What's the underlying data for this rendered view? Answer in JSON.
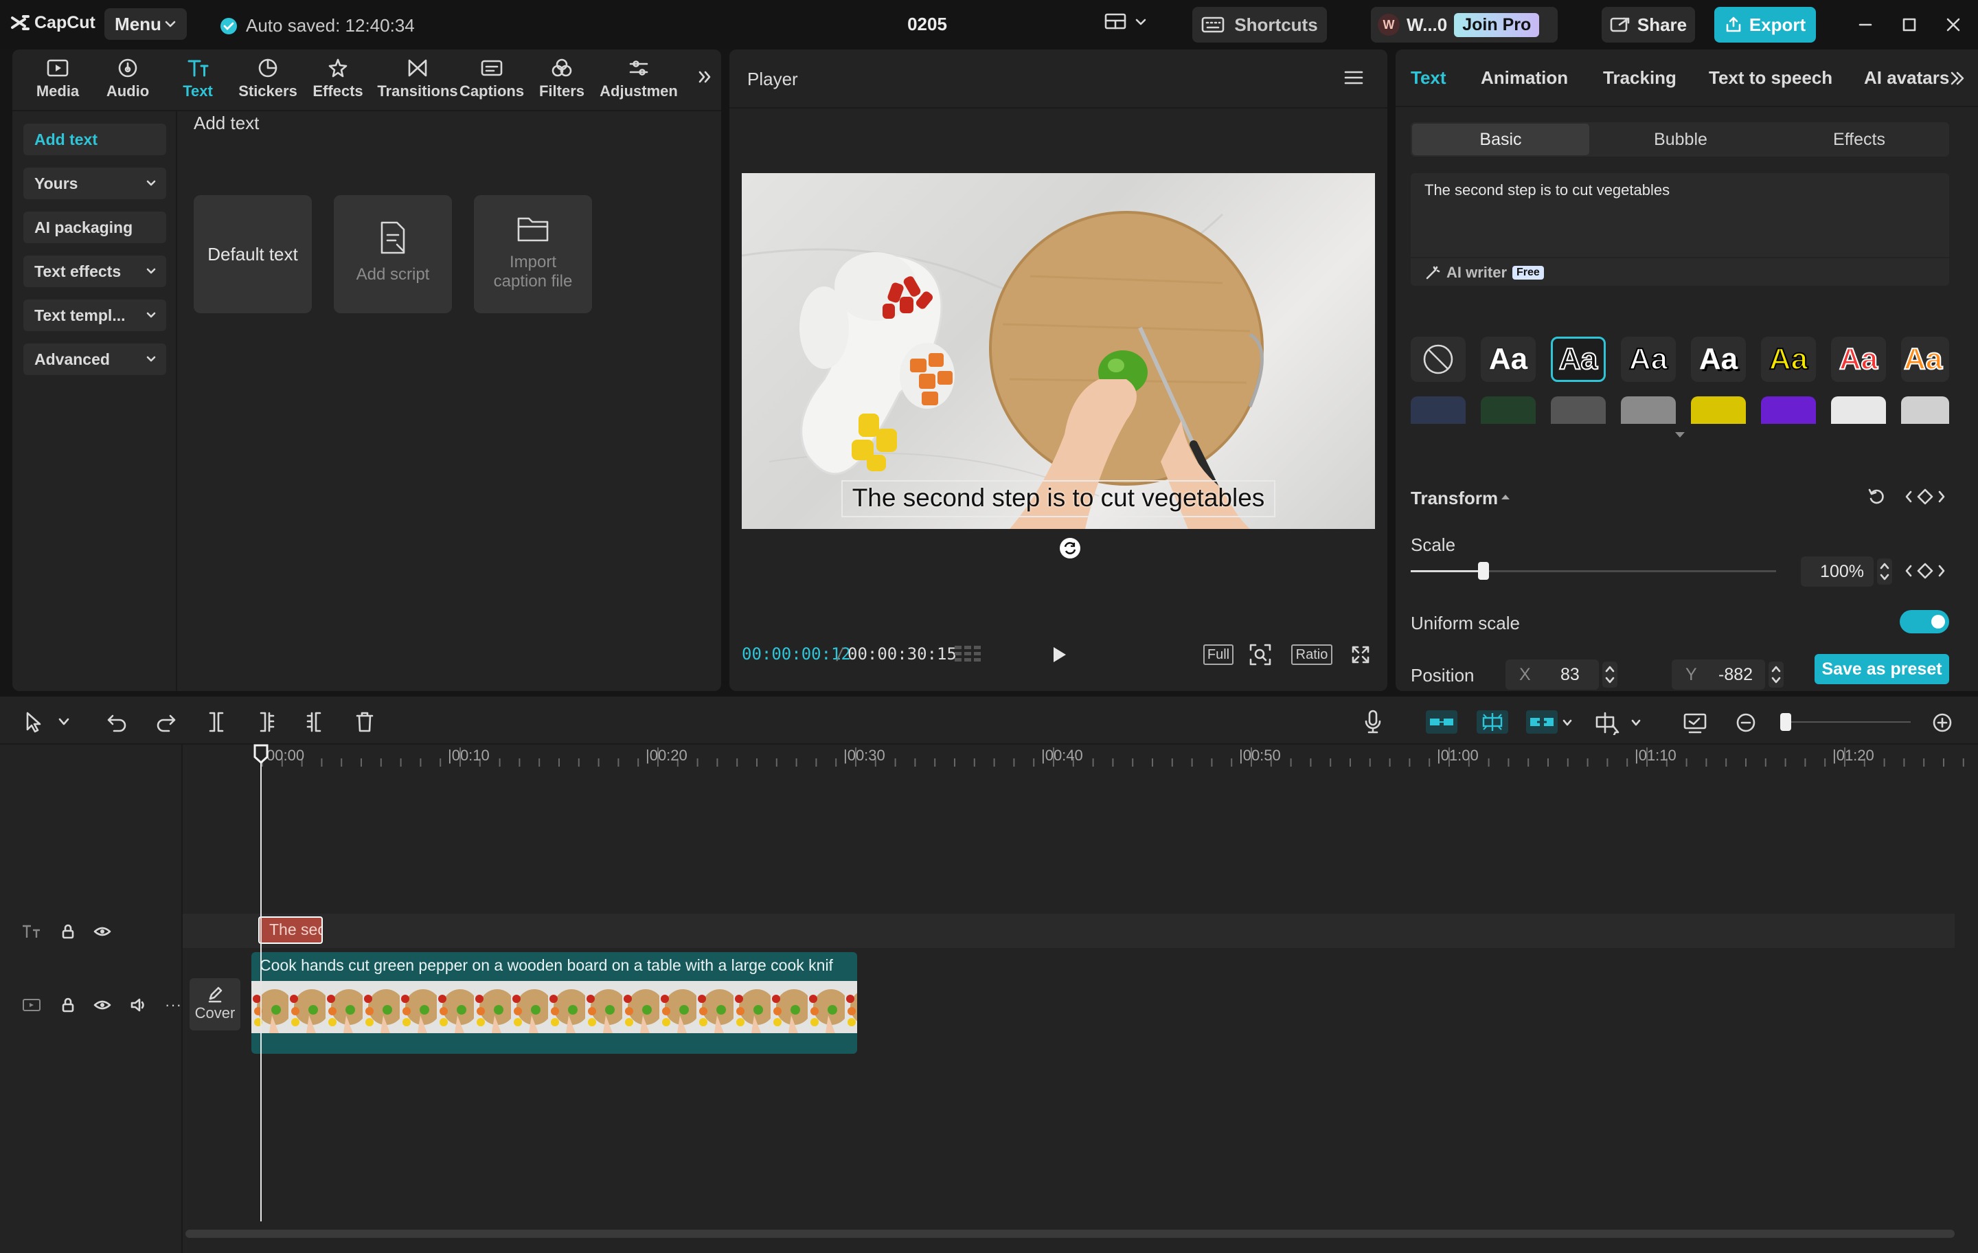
{
  "app": {
    "brand": "CapCut",
    "menu_label": "Menu",
    "autosave": "Auto saved: 12:40:34",
    "project_name": "0205",
    "shortcuts_label": "Shortcuts",
    "user_initial": "W",
    "user_name": "W...0",
    "join_pro_label": "Join Pro",
    "share_label": "Share",
    "export_label": "Export"
  },
  "toolbar": [
    {
      "label": "Media",
      "icon": "media-icon"
    },
    {
      "label": "Audio",
      "icon": "audio-icon"
    },
    {
      "label": "Text",
      "icon": "text-icon"
    },
    {
      "label": "Stickers",
      "icon": "stickers-icon"
    },
    {
      "label": "Effects",
      "icon": "effects-icon"
    },
    {
      "label": "Transitions",
      "icon": "transitions-icon"
    },
    {
      "label": "Captions",
      "icon": "captions-icon"
    },
    {
      "label": "Filters",
      "icon": "filters-icon"
    },
    {
      "label": "Adjustmen",
      "icon": "adjustment-icon"
    }
  ],
  "left_sidebar": {
    "add_text": "Add text",
    "yours": "Yours",
    "ai_packaging": "AI packaging",
    "text_effects": "Text effects",
    "text_templates": "Text templ...",
    "advanced": "Advanced"
  },
  "add_text_panel": {
    "heading": "Add text",
    "default_text": "Default text",
    "add_script": "Add script",
    "import_caption_line1": "Import",
    "import_caption_line2": "caption file"
  },
  "player": {
    "title": "Player",
    "caption": "The second step is to cut vegetables",
    "current_time": "00:00:00:12",
    "separator": "/",
    "total_time": "00:00:30:15",
    "full_label": "Full",
    "ratio_label": "Ratio"
  },
  "inspector": {
    "tabs": [
      "Text",
      "Animation",
      "Tracking",
      "Text to speech",
      "AI avatars"
    ],
    "subtabs": [
      "Basic",
      "Bubble",
      "Effects"
    ],
    "text_value": "The second step is to cut vegetables",
    "ai_writer": "AI writer",
    "free_badge": "Free",
    "preset_glyph": "Aa",
    "transform_label": "Transform",
    "scale_label": "Scale",
    "scale_value": "100%",
    "scale_fraction": 0.2,
    "uniform_scale_label": "Uniform scale",
    "uniform_scale_on": true,
    "position_label": "Position",
    "x_label": "X",
    "x_value": "83",
    "y_label": "Y",
    "y_value": "-882",
    "save_preset": "Save as preset"
  },
  "timeline": {
    "ticks": [
      "00:00",
      "|00:10",
      "|00:20",
      "|00:30",
      "|00:40",
      "|00:50",
      "|01:00",
      "|01:10",
      "|01:20"
    ],
    "text_clip_label": "The sec",
    "video_clip_label": "Cook hands cut green pepper on a wooden board on a table with a large cook knif",
    "cover_label": "Cover",
    "more_label": "···"
  },
  "colors": {
    "accent": "#2fc5d8",
    "export_bg": "#1ab3c9",
    "text_clip": "#a8463b",
    "video_clip": "#17595b"
  }
}
